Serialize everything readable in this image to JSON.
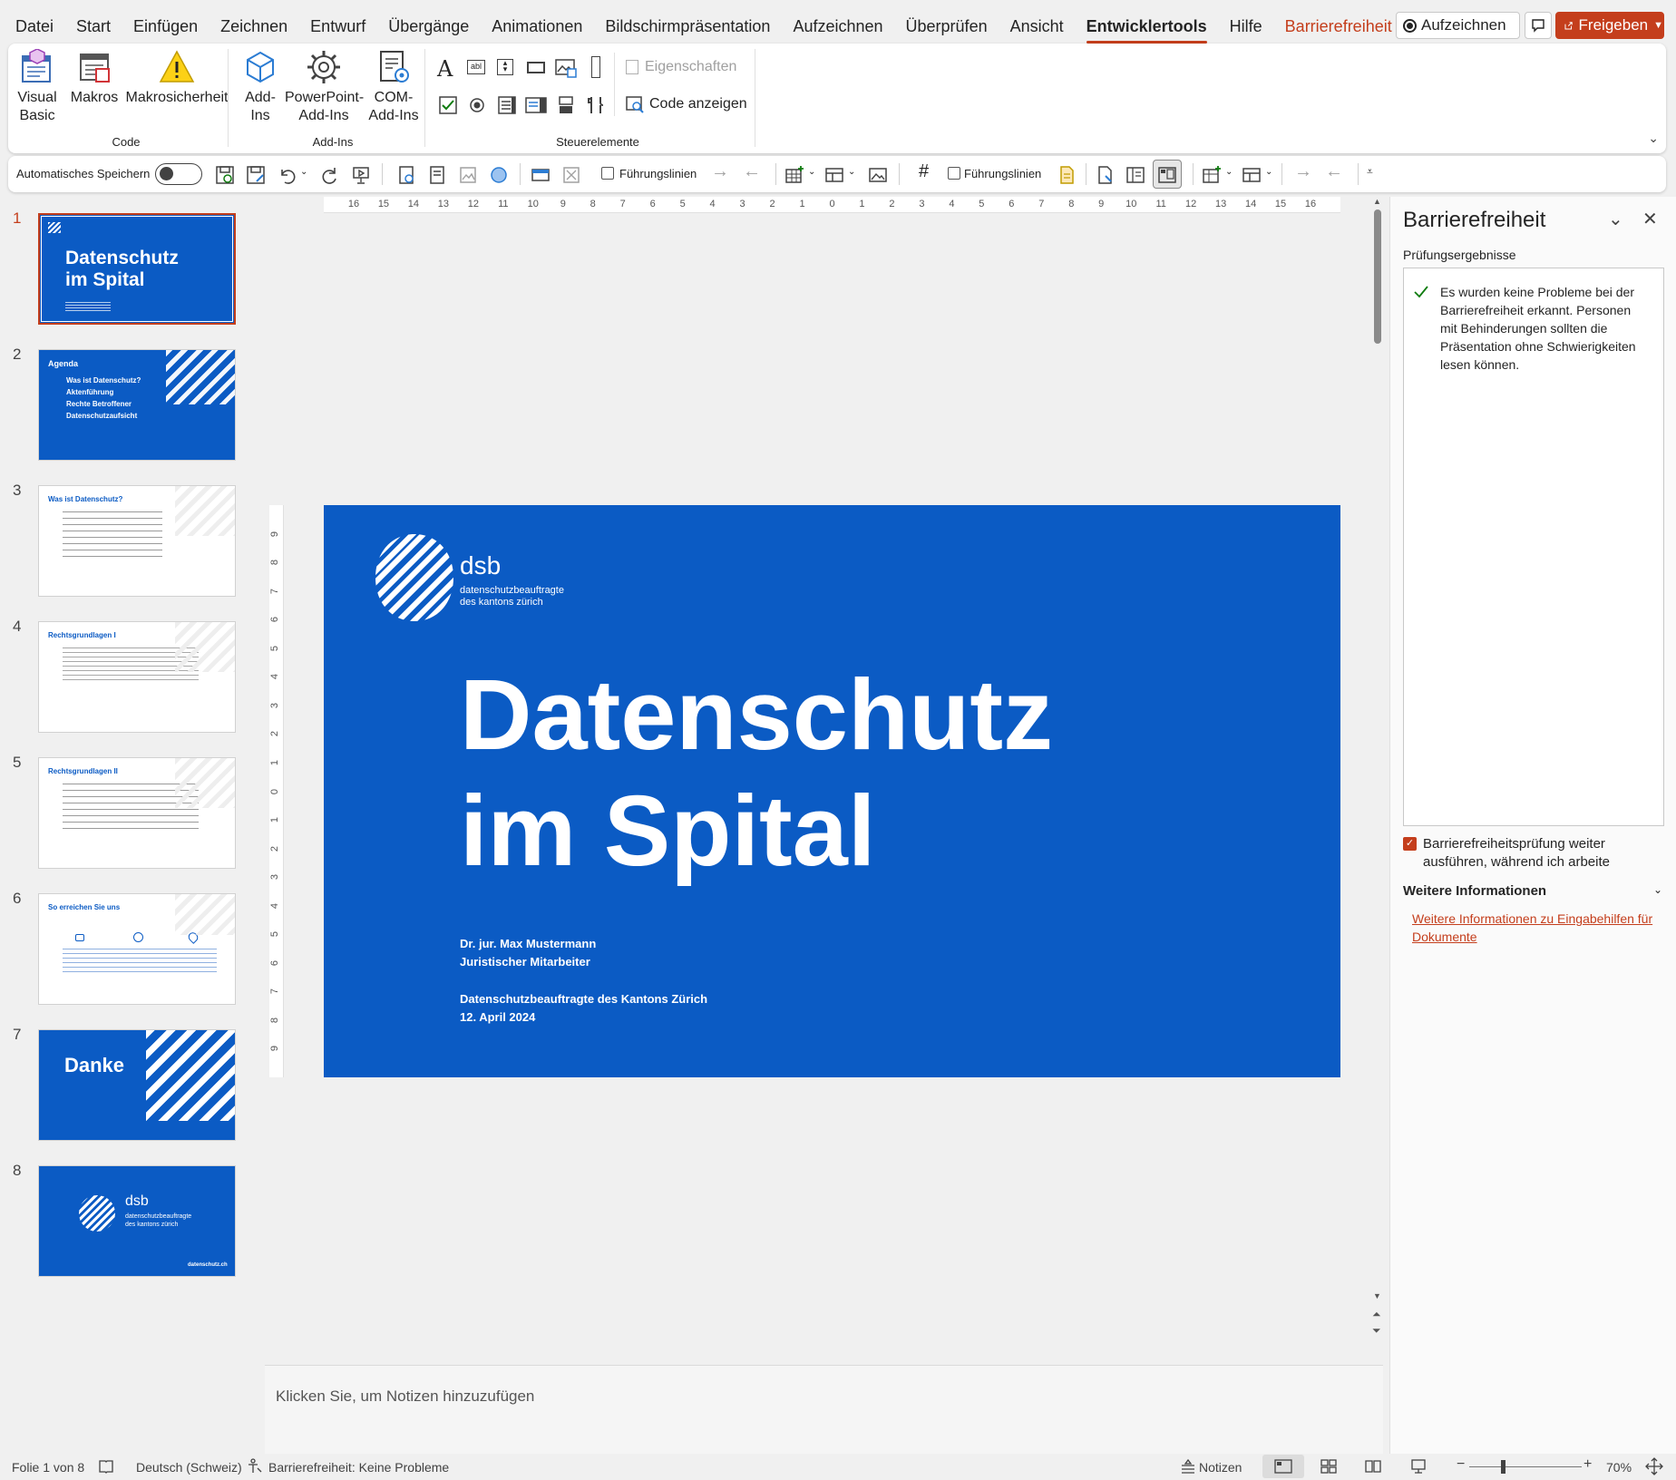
{
  "menu": {
    "tabs": [
      "Datei",
      "Start",
      "Einfügen",
      "Zeichnen",
      "Entwurf",
      "Übergänge",
      "Animationen",
      "Bildschirmpräsentation",
      "Aufzeichnen",
      "Überprüfen",
      "Ansicht",
      "Entwicklertools",
      "Hilfe",
      "Barrierefreiheit"
    ],
    "active_tab": "Entwicklertools",
    "record_label": "Aufzeichnen",
    "share_label": "Freigeben"
  },
  "ribbon": {
    "code_group": {
      "label": "Code",
      "visual_basic_line1": "Visual",
      "visual_basic_line2": "Basic",
      "macros": "Makros",
      "macro_security": "Makrosicherheit"
    },
    "addins_group": {
      "label": "Add-Ins",
      "addins_line1": "Add-",
      "addins_line2": "Ins",
      "ppt_addins_line1": "PowerPoint-",
      "ppt_addins_line2": "Add-Ins",
      "com_addins_line1": "COM-",
      "com_addins_line2": "Add-Ins"
    },
    "controls_group": {
      "label": "Steuerelemente",
      "properties": "Eigenschaften",
      "view_code": "Code anzeigen"
    }
  },
  "qat": {
    "autosave": "Automatisches Speichern",
    "guides1": "Führungslinien",
    "guides2": "Führungslinien"
  },
  "ruler": {
    "h_ticks": [
      "16",
      "15",
      "14",
      "13",
      "12",
      "11",
      "10",
      "9",
      "8",
      "7",
      "6",
      "5",
      "4",
      "3",
      "2",
      "1",
      "0",
      "1",
      "2",
      "3",
      "4",
      "5",
      "6",
      "7",
      "8",
      "9",
      "10",
      "11",
      "12",
      "13",
      "14",
      "15",
      "16"
    ],
    "v_ticks": [
      "9",
      "8",
      "7",
      "6",
      "5",
      "4",
      "3",
      "2",
      "1",
      "0",
      "1",
      "2",
      "3",
      "4",
      "5",
      "6",
      "7",
      "8",
      "9"
    ]
  },
  "thumbnails": [
    {
      "num": "1",
      "title_line1": "Datenschutz",
      "title_line2": "im Spital"
    },
    {
      "num": "2",
      "title": "Agenda",
      "items": [
        "Was ist Datenschutz?",
        "Aktenführung",
        "Rechte Betroffener",
        "Datenschutzaufsicht"
      ]
    },
    {
      "num": "3",
      "title": "Was ist Datenschutz?"
    },
    {
      "num": "4",
      "title": "Rechtsgrundlagen I"
    },
    {
      "num": "5",
      "title": "Rechtsgrundlagen II"
    },
    {
      "num": "6",
      "title": "So erreichen Sie uns"
    },
    {
      "num": "7",
      "title": "Danke"
    },
    {
      "num": "8",
      "logo": "dsb",
      "logo_sub1": "datenschutzbeauftragte",
      "logo_sub2": "des kantons zürich",
      "url": "datenschutz.ch"
    }
  ],
  "slide": {
    "logo": "dsb",
    "logo_sub1": "datenschutzbeauftragte",
    "logo_sub2": "des kantons zürich",
    "title_line1": "Datenschutz",
    "title_line2": "im Spital",
    "author": "Dr. jur. Max Mustermann",
    "role": "Juristischer Mitarbeiter",
    "org": "Datenschutzbeauftragte des Kantons Zürich",
    "date": "12. April 2024"
  },
  "notes_placeholder": "Klicken Sie, um Notizen hinzuzufügen",
  "pane": {
    "title": "Barrierefreiheit",
    "section": "Prüfungsergebnisse",
    "result": "Es wurden keine Probleme bei der Barrierefreiheit erkannt. Personen mit Behinderungen sollten die Präsentation ohne Schwierigkeiten lesen können.",
    "checkbox_label": "Barrierefreiheitsprüfung weiter ausführen, während ich arbeite",
    "more_info_heading": "Weitere Informationen",
    "more_info_link": "Weitere Informationen zu Eingabehilfen für Dokumente"
  },
  "status": {
    "slide_count": "Folie 1 von 8",
    "language": "Deutsch (Schweiz)",
    "accessibility": "Barrierefreiheit: Keine Probleme",
    "notes": "Notizen",
    "zoom": "70%"
  },
  "colors": {
    "accent": "#c43e1c",
    "slide_blue": "#0b5bc4",
    "check_green": "#107c10"
  }
}
